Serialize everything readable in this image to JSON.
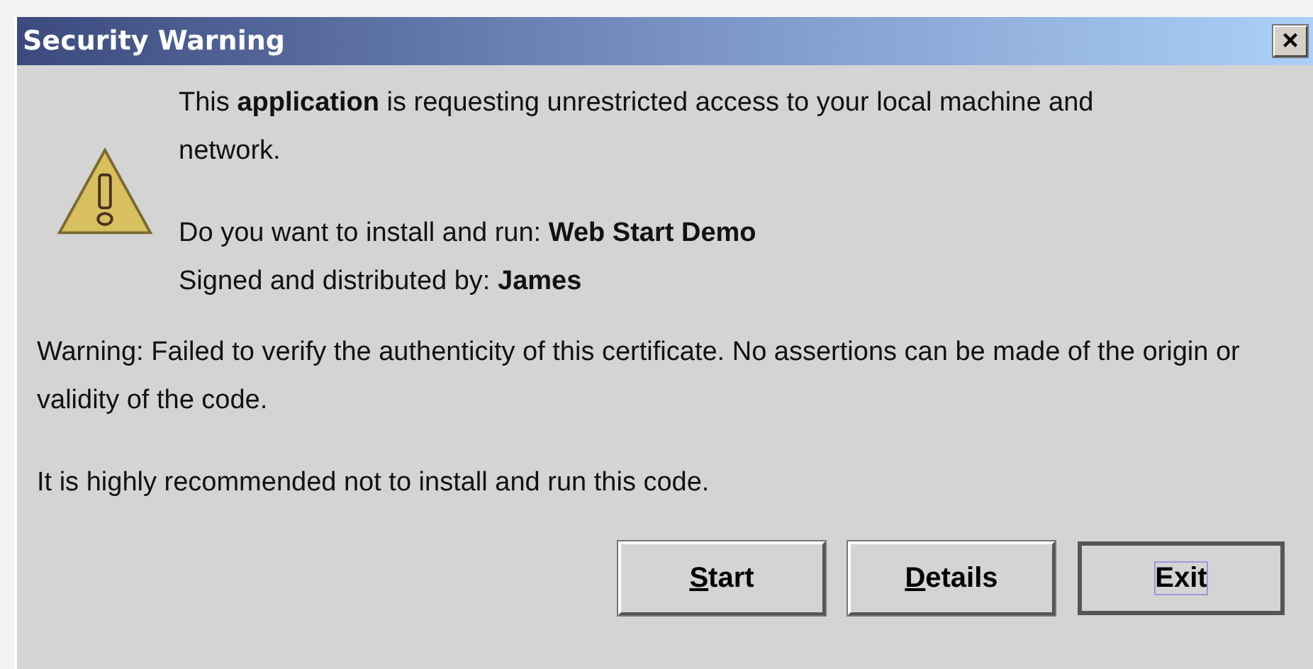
{
  "window": {
    "title": "Security Warning",
    "close": "×"
  },
  "message": {
    "intro": "This **application** is requesting unrestricted access to your local machine and network.",
    "install": "Do you want to install and run: **Web Start Demo**",
    "signer": "Signed and distributed by: **James**"
  },
  "warnings": [
    "Warning: Failed to verify the authenticity of this certificate. No assertions can be made of the origin or validity of the code.",
    "It is highly recommended not to install and run this code."
  ],
  "buttons": [
    {
      "label": "Start",
      "mnemonic": true,
      "focused": false
    },
    {
      "label": "Details",
      "mnemonic": true,
      "focused": false
    },
    {
      "label": "Exit",
      "mnemonic": false,
      "focused": true
    }
  ]
}
